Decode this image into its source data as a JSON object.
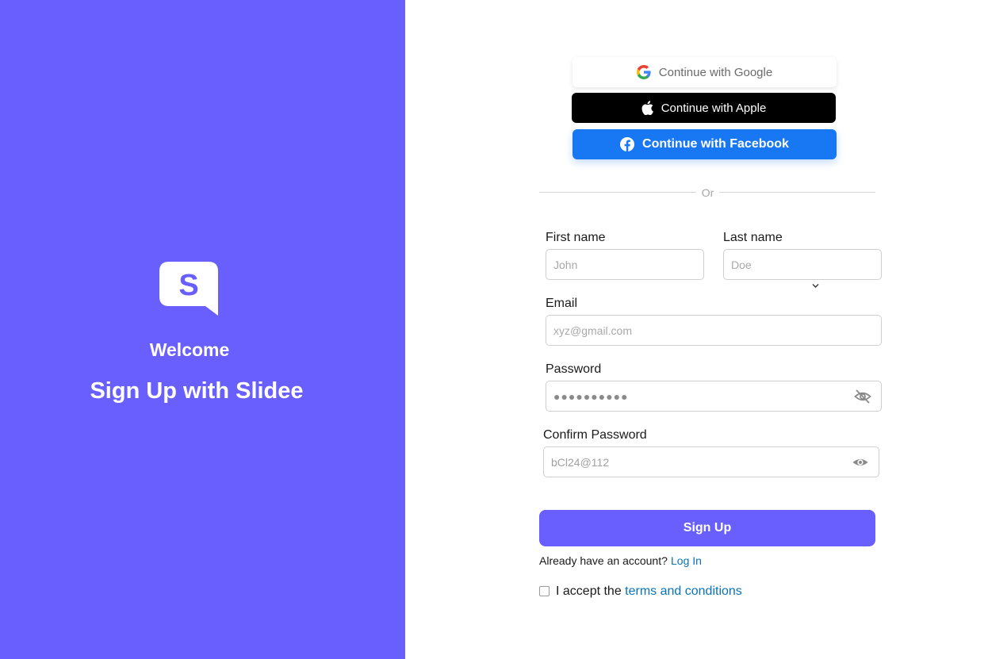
{
  "brand": {
    "logo_letter": "S",
    "welcome": "Welcome",
    "headline": "Sign Up with Slidee",
    "color": "#695ffe"
  },
  "social": {
    "google": {
      "label": "Continue with Google",
      "icon": "google-icon"
    },
    "apple": {
      "label": "Continue with Apple",
      "icon": "apple-icon"
    },
    "facebook": {
      "label": "Continue with Facebook",
      "icon": "facebook-icon",
      "color": "#1877f2"
    }
  },
  "divider": {
    "label": "Or"
  },
  "form": {
    "first_name": {
      "label": "First name",
      "placeholder": "John"
    },
    "last_name": {
      "label": "Last name",
      "placeholder": "Doe"
    },
    "email": {
      "label": "Email",
      "placeholder": "xyz@gmail.com"
    },
    "password": {
      "label": "Password",
      "masked_value": "●●●●●●●●●●",
      "icon": "eye-off-icon"
    },
    "confirm_password": {
      "label": "Confirm Password",
      "value": "bCl24@112",
      "icon": "eye-icon"
    },
    "submit_label": "Sign Up"
  },
  "footer": {
    "account_prompt": "Already have an account?",
    "login_link": "Log In",
    "terms_prefix": "I accept the",
    "terms_link": "terms and conditions",
    "link_color": "#0a73b8"
  }
}
